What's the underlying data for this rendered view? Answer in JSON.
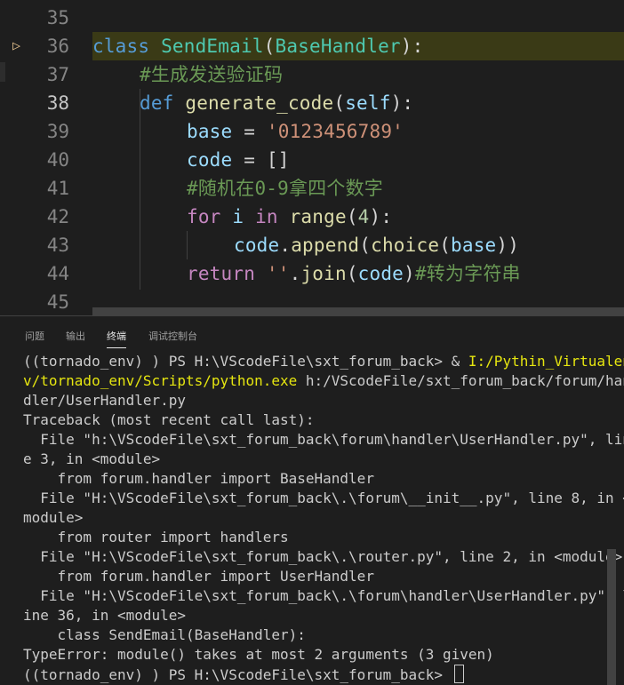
{
  "editor": {
    "lines": [
      {
        "n": "35"
      },
      {
        "n": "36",
        "kw": "class",
        "cls": "SendEmail",
        "base": "BaseHandler"
      },
      {
        "n": "37",
        "comment": "#生成发送验证码"
      },
      {
        "n": "38",
        "kw": "def",
        "fn": "generate_code",
        "param": "self"
      },
      {
        "n": "39",
        "var": "base",
        "str": "'0123456789'"
      },
      {
        "n": "40",
        "var": "code",
        "rhs": "[]"
      },
      {
        "n": "41",
        "comment": "#随机在0-9拿四个数字"
      },
      {
        "n": "42",
        "kw": "for",
        "var": "i",
        "kw2": "in",
        "fn": "range",
        "num": "4"
      },
      {
        "n": "43",
        "var": "code",
        "method": "append",
        "fn": "choice",
        "arg": "base"
      },
      {
        "n": "44",
        "kw": "return",
        "str": "''",
        "method": "join",
        "arg": "code",
        "comment": "#转为字符串"
      },
      {
        "n": "45"
      }
    ]
  },
  "panel": {
    "tabs": [
      "问题",
      "输出",
      "终端",
      "调试控制台"
    ],
    "active_tab": "终端"
  },
  "terminal": {
    "prompt1": "((tornado_env) ) PS H:\\VScodeFile\\sxt_forum_back> & ",
    "exe_part1": "I:/Pythin_Virtualen",
    "exe_part2": "v/tornado_env/Scripts/python.exe",
    "arg_part1": " h:/VScodeFile/sxt_forum_back/forum/han",
    "arg_part2": "dler/UserHandler.py",
    "lines": [
      "Traceback (most recent call last):",
      "  File \"h:\\VScodeFile\\sxt_forum_back\\forum\\handler\\UserHandler.py\", lin",
      "e 3, in <module>",
      "    from forum.handler import BaseHandler",
      "  File \"H:\\VScodeFile\\sxt_forum_back\\.\\forum\\__init__.py\", line 8, in <",
      "module>",
      "    from router import handlers",
      "  File \"H:\\VScodeFile\\sxt_forum_back\\.\\router.py\", line 2, in <module>",
      "    from forum.handler import UserHandler",
      "  File \"H:\\VScodeFile\\sxt_forum_back\\.\\forum\\handler\\UserHandler.py\", l",
      "ine 36, in <module>",
      "    class SendEmail(BaseHandler):",
      "TypeError: module() takes at most 2 arguments (3 given)"
    ],
    "prompt_final": "((tornado_env) ) PS H:\\VScodeFile\\sxt_forum_back> "
  }
}
